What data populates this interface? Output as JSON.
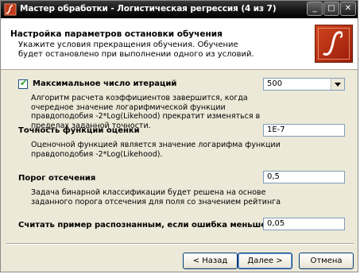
{
  "window": {
    "title": "Мастер обработки - Логистическая регрессия (4 из 7)",
    "controls": {
      "minimize": "_",
      "maximize": "□",
      "close": "✕"
    }
  },
  "header": {
    "title": "Настройка параметров остановки обучения",
    "subtitle": "Укажите условия прекращения обучения. Обучение будет остановлено при выполнении одного из условий."
  },
  "max_iterations": {
    "checked": true,
    "label": "Максимальное число итераций",
    "value": "500",
    "description": "Алгоритм расчета коэффициентов завершится, когда очередное значение логарифмической функции правдоподобия -2*Log(Likehood) прекратит изменяться в пределах заданной точности."
  },
  "accuracy": {
    "label": "Точность функции оценки",
    "value": "1E-7",
    "description": "Оценочной функцией является значение логарифма функции правдоподобия -2*Log(Likehood)."
  },
  "threshold": {
    "label": "Порог отсечения",
    "value": "0,5",
    "description": "Задача бинарной классификации будет решена на основе заданного порога отсечения для поля со значением рейтинга"
  },
  "error_threshold": {
    "label": "Считать пример распознанным, если ошибка меньше",
    "value": "0,05"
  },
  "buttons": {
    "back": "< Назад",
    "next": "Далее >",
    "cancel": "Отмена"
  }
}
